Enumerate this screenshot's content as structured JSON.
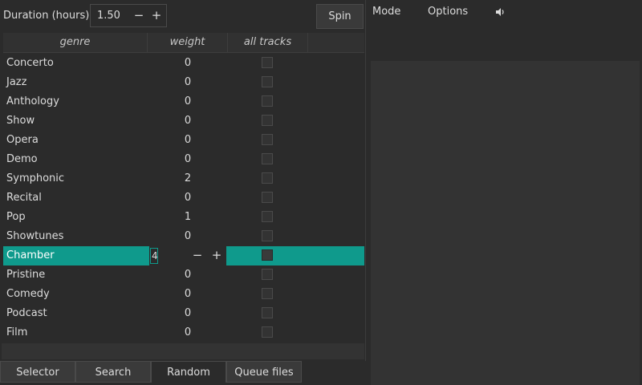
{
  "duration": {
    "label": "Duration (hours):",
    "value": "1.50",
    "minus": "−",
    "plus": "+"
  },
  "spin_label": "Spin",
  "table": {
    "headers": [
      "genre",
      "weight",
      "all tracks"
    ],
    "rows": [
      {
        "genre": "Concerto",
        "weight": "0",
        "all_tracks": false
      },
      {
        "genre": "Jazz",
        "weight": "0",
        "all_tracks": false
      },
      {
        "genre": "Anthology",
        "weight": "0",
        "all_tracks": false
      },
      {
        "genre": "Show",
        "weight": "0",
        "all_tracks": false
      },
      {
        "genre": "Opera",
        "weight": "0",
        "all_tracks": false
      },
      {
        "genre": "Demo",
        "weight": "0",
        "all_tracks": false
      },
      {
        "genre": "Symphonic",
        "weight": "2",
        "all_tracks": false
      },
      {
        "genre": "Recital",
        "weight": "0",
        "all_tracks": false
      },
      {
        "genre": "Pop",
        "weight": "1",
        "all_tracks": false
      },
      {
        "genre": "Showtunes",
        "weight": "0",
        "all_tracks": false
      },
      {
        "genre": "Chamber",
        "weight": "4",
        "all_tracks": false,
        "selected": true
      },
      {
        "genre": "Pristine",
        "weight": "0",
        "all_tracks": false
      },
      {
        "genre": "Comedy",
        "weight": "0",
        "all_tracks": false
      },
      {
        "genre": "Podcast",
        "weight": "0",
        "all_tracks": false
      },
      {
        "genre": "Film",
        "weight": "0",
        "all_tracks": false
      }
    ],
    "edit": {
      "minus": "−",
      "plus": "+"
    }
  },
  "tabs": [
    {
      "label": "Selector",
      "active": false
    },
    {
      "label": "Search",
      "active": false
    },
    {
      "label": "Random",
      "active": true
    },
    {
      "label": "Queue files",
      "active": false
    }
  ],
  "menu": {
    "mode": "Mode",
    "options": "Options",
    "volume_icon": "speaker-icon"
  },
  "colors": {
    "accent": "#0f9a8c",
    "background": "#2b2b2b"
  }
}
